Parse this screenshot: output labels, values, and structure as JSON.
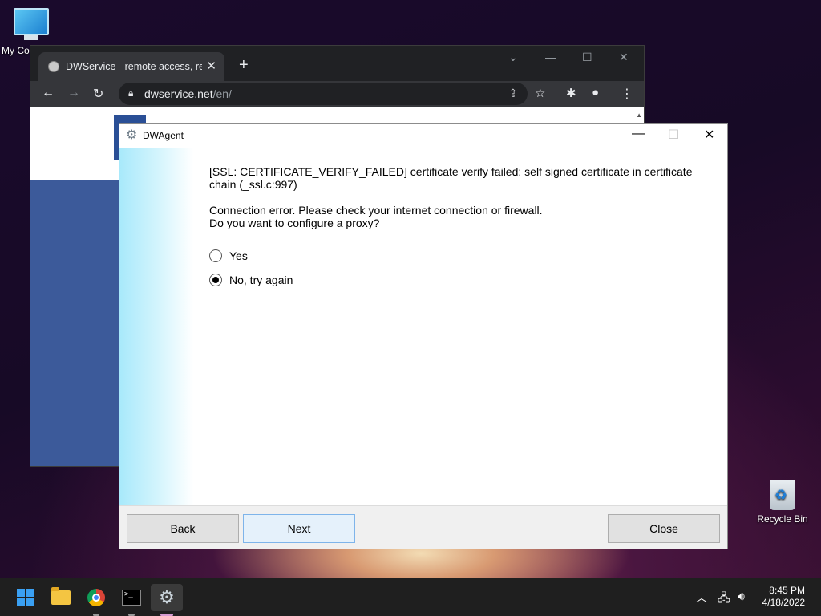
{
  "desktop": {
    "icons": [
      {
        "label": "My Co",
        "icon": "computer-icon"
      },
      {
        "label": "Recycle Bin",
        "icon": "recycle-bin-icon"
      }
    ]
  },
  "browser": {
    "tab_title": "DWService - remote access, remo",
    "url_host": "dwservice.net",
    "url_path": "/en/",
    "icons": [
      "back-arrow-icon",
      "forward-arrow-icon",
      "reload-icon",
      "lock-icon",
      "share-icon",
      "star-icon",
      "extensions-icon",
      "profile-icon",
      "menu-dots-icon"
    ]
  },
  "dialog": {
    "title": "DWAgent",
    "error_line": "[SSL: CERTIFICATE_VERIFY_FAILED] certificate verify failed: self signed certificate in certificate chain (_ssl.c:997)",
    "message_line1": "Connection error. Please check your internet connection or firewall.",
    "message_line2": "Do you want to configure a proxy?",
    "options": [
      {
        "label": "Yes",
        "checked": false
      },
      {
        "label": "No, try again",
        "checked": true
      }
    ],
    "buttons": {
      "back": "Back",
      "next": "Next",
      "close": "Close"
    }
  },
  "taskbar": {
    "time": "8:45 PM",
    "date": "4/18/2022"
  },
  "colors": {
    "dialog_accent": "#a8e9fb",
    "chrome_dark": "#202124",
    "taskbar": "#1f1f1f"
  }
}
